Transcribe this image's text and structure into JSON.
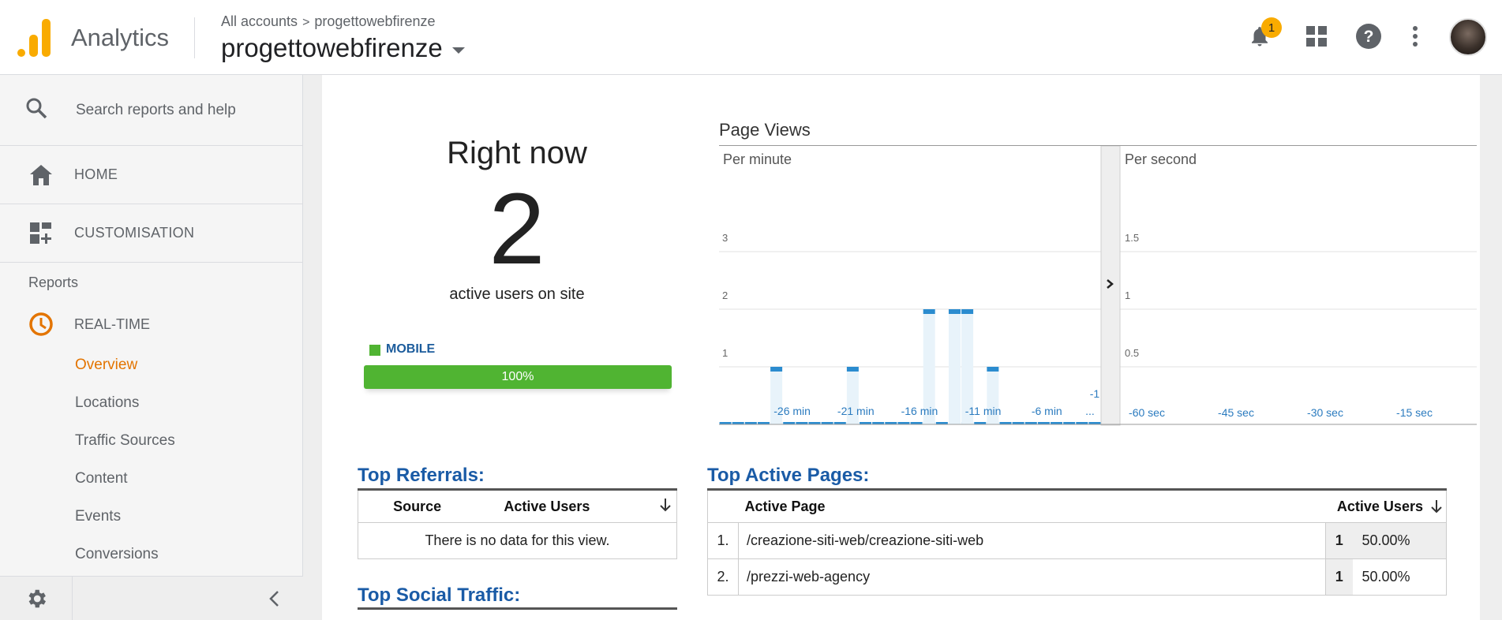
{
  "app": {
    "name": "Analytics"
  },
  "header": {
    "breadcrumb_root": "All accounts",
    "breadcrumb_sep": ">",
    "breadcrumb_account": "progettowebfirenze",
    "account_name": "progettowebfirenze",
    "notification_count": "1",
    "icons": [
      "bell-icon",
      "apps-grid-icon",
      "help-icon",
      "more-vert-icon"
    ]
  },
  "sidebar": {
    "search_placeholder": "Search reports and help",
    "home_label": "HOME",
    "customisation_label": "CUSTOMISATION",
    "reports_label": "Reports",
    "realtime_label": "REAL-TIME",
    "sub_items": [
      {
        "label": "Overview",
        "active": true
      },
      {
        "label": "Locations"
      },
      {
        "label": "Traffic Sources"
      },
      {
        "label": "Content"
      },
      {
        "label": "Events"
      },
      {
        "label": "Conversions"
      }
    ]
  },
  "right_now": {
    "title": "Right now",
    "count": "2",
    "subtitle": "active users on site",
    "device_label": "MOBILE",
    "device_percent": "100%",
    "device_fraction": 1.0,
    "device_color": "#50b432"
  },
  "page_views": {
    "title": "Page Views"
  },
  "chart_data": [
    {
      "type": "bar",
      "title": "Per minute",
      "x_tick_labels": [
        "-26 min",
        "-21 min",
        "-16 min",
        "-11 min",
        "-6 min",
        "-1 ..."
      ],
      "categories": [
        -30,
        -29,
        -28,
        -27,
        -26,
        -25,
        -24,
        -23,
        -22,
        -21,
        -20,
        -19,
        -18,
        -17,
        -16,
        -15,
        -14,
        -13,
        -12,
        -11,
        -10,
        -9,
        -8,
        -7,
        -6,
        -5,
        -4,
        -3,
        -2,
        -1
      ],
      "values": [
        0,
        0,
        0,
        0,
        1,
        0,
        0,
        0,
        0,
        0,
        1,
        0,
        0,
        0,
        0,
        0,
        2,
        0,
        2,
        2,
        0,
        1,
        0,
        0,
        0,
        0,
        0,
        0,
        0,
        0
      ],
      "y_ticks": [
        "3",
        "2",
        "1"
      ],
      "ylim": [
        0,
        3
      ],
      "grid": true
    },
    {
      "type": "bar",
      "title": "Per second",
      "x_tick_labels": [
        "-60 sec",
        "-45 sec",
        "-30 sec",
        "-15 sec"
      ],
      "values": [],
      "y_ticks": [
        "1.5",
        "1",
        "0.5"
      ],
      "ylim": [
        0,
        1.5
      ],
      "grid": true
    }
  ],
  "top_referrals": {
    "title": "Top Referrals:",
    "col_source": "Source",
    "col_users": "Active Users",
    "empty_message": "There is no data for this view."
  },
  "top_social": {
    "title": "Top Social Traffic:"
  },
  "top_pages": {
    "title": "Top Active Pages:",
    "col_page": "Active Page",
    "col_users": "Active Users",
    "rows": [
      {
        "rank": "1.",
        "page": "/creazione-siti-web/creazione-siti-web",
        "users": "1",
        "percent": "50.00%"
      },
      {
        "rank": "2.",
        "page": "/prezzi-web-agency",
        "users": "1",
        "percent": "50.00%"
      }
    ]
  },
  "colors": {
    "accent_orange": "#e37400",
    "link_blue": "#1a5ba6",
    "bar_blue": "#2b8ccf",
    "bar_fill": "#e8f3fa"
  }
}
